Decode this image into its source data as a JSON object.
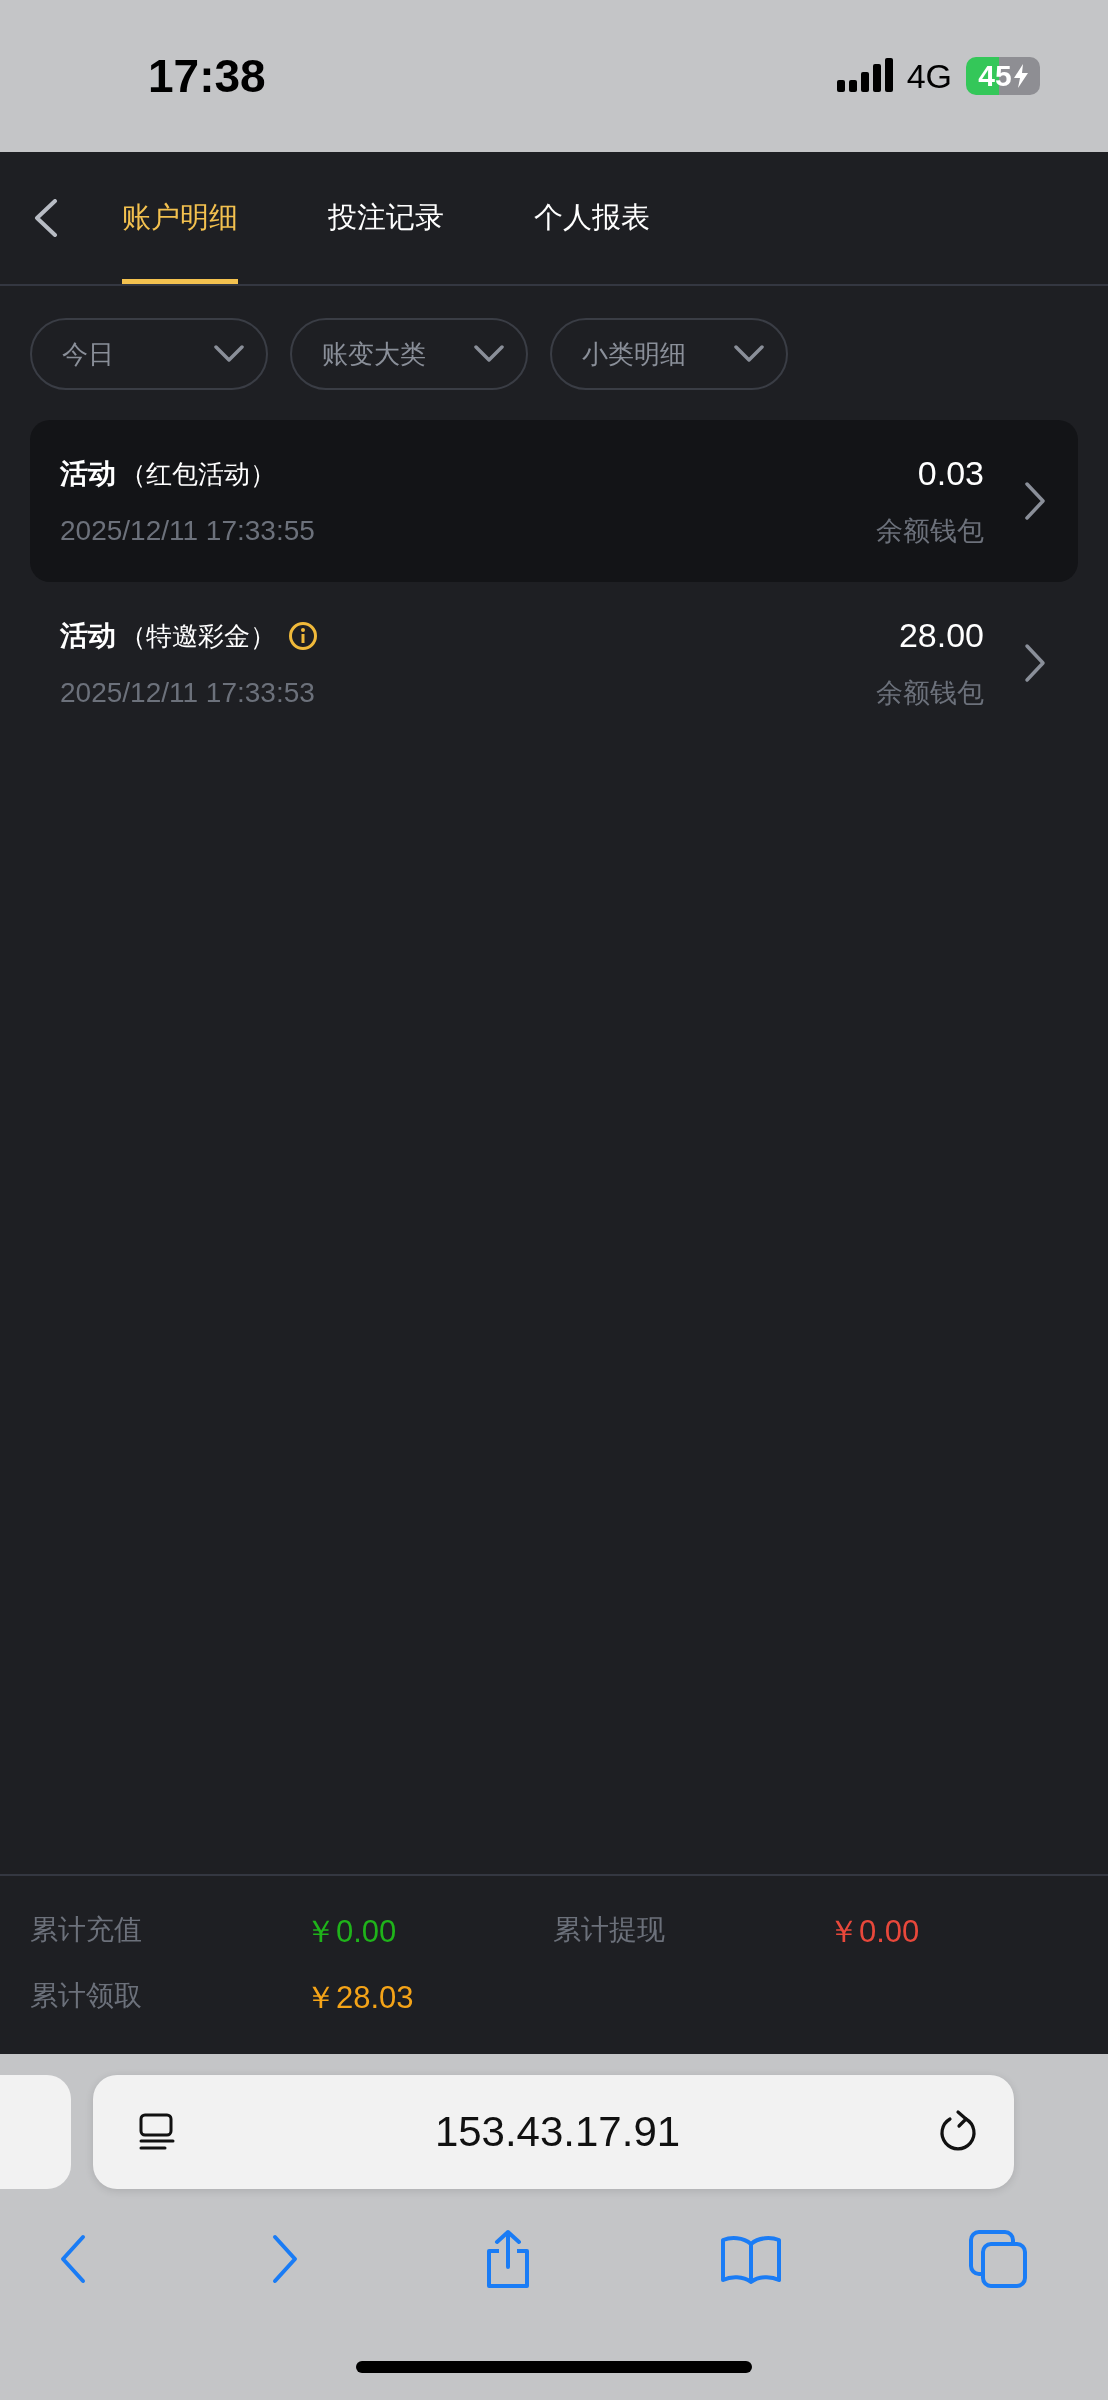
{
  "status_bar": {
    "time": "17:38",
    "network": "4G",
    "battery": "45",
    "charging": true
  },
  "tabs": [
    {
      "label": "账户明细",
      "selected": true
    },
    {
      "label": "投注记录",
      "selected": false
    },
    {
      "label": "个人报表",
      "selected": false
    }
  ],
  "filters": [
    {
      "label": "今日"
    },
    {
      "label": "账变大类"
    },
    {
      "label": "小类明细"
    }
  ],
  "records": [
    {
      "category": "活动",
      "detail": "（红包活动）",
      "info": false,
      "time": "2025/12/11 17:33:55",
      "amount": "0.03",
      "wallet": "余额钱包",
      "selected": true
    },
    {
      "category": "活动",
      "detail": "（特邀彩金）",
      "info": true,
      "time": "2025/12/11 17:33:53",
      "amount": "28.00",
      "wallet": "余额钱包",
      "selected": false
    }
  ],
  "summary": [
    {
      "label": "累计充值",
      "value": "￥0.00",
      "color": "#1fb41a"
    },
    {
      "label": "累计提现",
      "value": "￥0.00",
      "color": "#e8483b"
    },
    {
      "label": "累计领取",
      "value": "￥28.03",
      "color": "#f5a418"
    }
  ],
  "browser": {
    "url": "153.43.17.91"
  }
}
